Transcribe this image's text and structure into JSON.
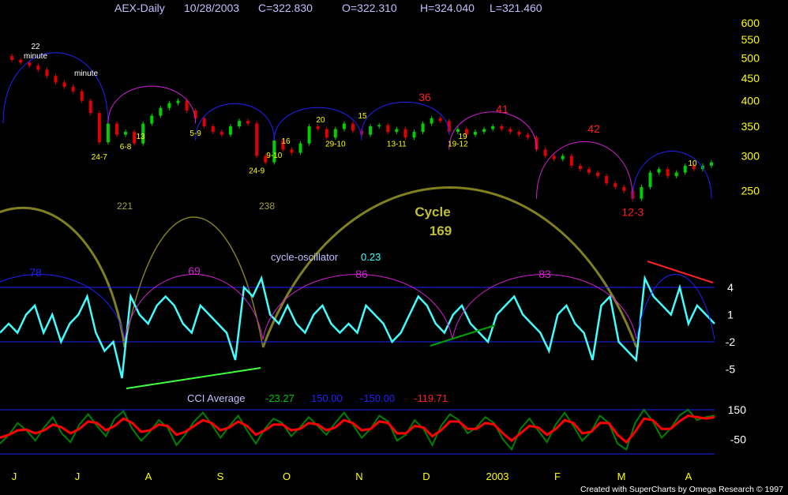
{
  "header": {
    "symbol": "AEX-Daily",
    "date": "10/28/2003",
    "close": "C=322.830",
    "open": "O=322.310",
    "high": "H=324.040",
    "low": "L=321.460"
  },
  "footer": "Created with SuperCharts by Omega Research © 1997",
  "colors": {
    "background": "#000000",
    "price_axis": "#ffff00",
    "cycle_label": "#ffff00",
    "trough_label": "#ffff00",
    "major_cycle": "#808020",
    "arc_blue": "#2020ff",
    "arc_magenta": "#d020d0",
    "oscillator": "#40ffff",
    "cci_green": "#008000",
    "cci_red": "#ff0000",
    "trend_red": "#ff2020",
    "trend_green": "#40ff40",
    "cycle_number_red": "#ff2020",
    "osc_cycle_blue": "#2020ff",
    "osc_cycle_magenta": "#d020d0"
  },
  "chart_data": [
    {
      "type": "candlestick",
      "title": "AEX-Daily",
      "ylim": [
        230,
        610
      ],
      "y_ticks": [
        "600",
        "550",
        "500",
        "450",
        "400",
        "350",
        "300",
        "250"
      ],
      "x_ticks": [
        "J",
        "J",
        "A",
        "S",
        "O",
        "N",
        "D",
        "2003",
        "F",
        "M",
        "A"
      ],
      "trough_labels": [
        "24-7",
        "6-8",
        "5-9",
        "24-9",
        "9-10",
        "29-10",
        "13-11",
        "19-12",
        "12-3"
      ],
      "cycle_labels": [
        "22",
        "minute",
        "minute",
        "13",
        "16",
        "20",
        "15",
        "19",
        "10",
        "36",
        "41",
        "42"
      ],
      "major_cycle_labels": [
        "221",
        "238",
        "Cycle",
        "169"
      ],
      "close_series": [
        505,
        495,
        488,
        480,
        470,
        455,
        440,
        430,
        420,
        400,
        375,
        322,
        355,
        335,
        340,
        320,
        355,
        370,
        385,
        395,
        400,
        380,
        365,
        350,
        340,
        335,
        350,
        360,
        355,
        300,
        290,
        325,
        310,
        305,
        320,
        350,
        345,
        330,
        345,
        355,
        342,
        335,
        350,
        352,
        340,
        345,
        330,
        340,
        355,
        365,
        360,
        340,
        345,
        335,
        340,
        345,
        350,
        345,
        340,
        335,
        330,
        310,
        300,
        295,
        300,
        285,
        280,
        275,
        270,
        260,
        255,
        250,
        240,
        255,
        275,
        280,
        270,
        275,
        285,
        280,
        285,
        290
      ]
    },
    {
      "type": "line",
      "title": "cycle-oscillator",
      "current_value": "0.23",
      "y_ticks": [
        "4",
        "1",
        "-2",
        "-5"
      ],
      "cycle_labels": [
        "78",
        "69",
        "86",
        "83"
      ],
      "series": [
        {
          "values": [
            -1,
            0,
            -1,
            1,
            2,
            -1,
            1,
            -2,
            0,
            1,
            3,
            -1,
            -3,
            -2,
            -6,
            3,
            1,
            0,
            2,
            3,
            2,
            0,
            -1,
            2,
            1,
            0,
            -1,
            -4,
            4,
            3,
            5,
            1,
            0,
            2,
            0,
            -1,
            1,
            2,
            0,
            -1,
            0,
            -1,
            2,
            1,
            0,
            -2,
            -1,
            1,
            3,
            2,
            0,
            -1,
            1,
            2,
            0,
            -1,
            -2,
            1,
            2,
            3,
            1,
            0,
            -1,
            -3,
            1,
            2,
            0,
            -1,
            -4,
            2,
            3,
            -2,
            -3,
            -4,
            5,
            3,
            2,
            1,
            4,
            0,
            2,
            1,
            0
          ]
        }
      ]
    },
    {
      "type": "line",
      "title": "CCI Average",
      "y_ticks": [
        "150",
        "-50"
      ],
      "values_text": [
        "-23.27",
        "150.00",
        "-150.00",
        "-119.71"
      ],
      "series": [
        {
          "values": [
            -80,
            -20,
            60,
            10,
            -60,
            30,
            100,
            -10,
            -70,
            50,
            120,
            40,
            -30,
            90,
            140,
            20,
            -60,
            0,
            80,
            30,
            -90,
            -20,
            70,
            130,
            50,
            -40,
            40,
            110,
            10,
            -80,
            20,
            90,
            60,
            -30,
            30,
            100,
            40,
            -20,
            60,
            130,
            50,
            -40,
            20,
            110,
            70,
            -60,
            -20,
            80,
            20,
            -90,
            40,
            120,
            80,
            -10,
            30,
            100,
            60,
            -50,
            -120,
            20,
            90,
            10,
            -70,
            50,
            130,
            40,
            -60,
            0,
            110,
            60,
            -80,
            -120,
            60,
            150,
            70,
            -40,
            20,
            110,
            150,
            80,
            100,
            110
          ]
        },
        {
          "values": [
            -40,
            -20,
            10,
            15,
            -10,
            10,
            50,
            30,
            -10,
            20,
            70,
            60,
            10,
            40,
            90,
            60,
            0,
            10,
            50,
            40,
            -20,
            0,
            40,
            80,
            60,
            10,
            30,
            70,
            40,
            -20,
            10,
            50,
            50,
            10,
            20,
            60,
            50,
            10,
            30,
            80,
            60,
            10,
            20,
            70,
            60,
            -10,
            -10,
            40,
            30,
            -30,
            10,
            70,
            70,
            20,
            20,
            60,
            50,
            -10,
            -60,
            -10,
            40,
            30,
            -20,
            20,
            80,
            60,
            -10,
            0,
            60,
            60,
            -20,
            -70,
            0,
            90,
            80,
            20,
            20,
            70,
            110,
            100,
            90,
            100
          ]
        }
      ]
    }
  ]
}
